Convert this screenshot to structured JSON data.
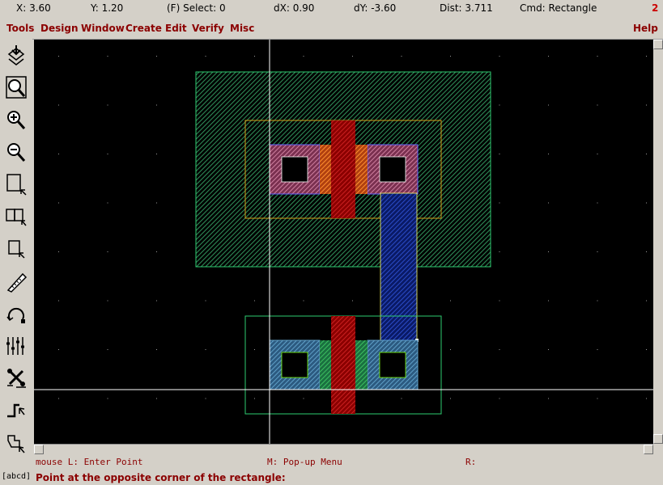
{
  "status": {
    "x": "X:  3.60",
    "y": "Y:  1.20",
    "select": "(F) Select: 0",
    "dx": "dX:  0.90",
    "dy": "dY:  -3.60",
    "dist": "Dist: 3.711",
    "cmd": "Cmd: Rectangle",
    "window_number": "2"
  },
  "menu": {
    "tools": "Tools",
    "design": "Design",
    "window": "Window",
    "create": "Create",
    "edit": "Edit",
    "verify": "Verify",
    "misc": "Misc",
    "help": "Help"
  },
  "toolbar_icons": [
    "save-view-icon",
    "zoom-fit-icon",
    "zoom-in-icon",
    "zoom-out-icon",
    "zoom-box-icon",
    "pan-icon",
    "select-box-icon",
    "ruler-icon",
    "undo-icon",
    "stretch-icon",
    "move-icon",
    "path-icon",
    "polygon-icon"
  ],
  "labels_button": "[abcd]",
  "mouse_help": {
    "left": "mouse L: Enter Point",
    "middle": "M: Pop-up Menu",
    "right": "R:"
  },
  "prompt": "Point at the opposite corner of the rectangle:",
  "colors": {
    "background": "#000000",
    "nwell": "#2e8b57",
    "pselect": "#d4a017",
    "poly": "#cc2222",
    "active_p": "#d08080",
    "active_n": "#4682b4",
    "metal1": "#1e3a8a",
    "contact": "#000000",
    "crosshair": "#ffffff"
  }
}
